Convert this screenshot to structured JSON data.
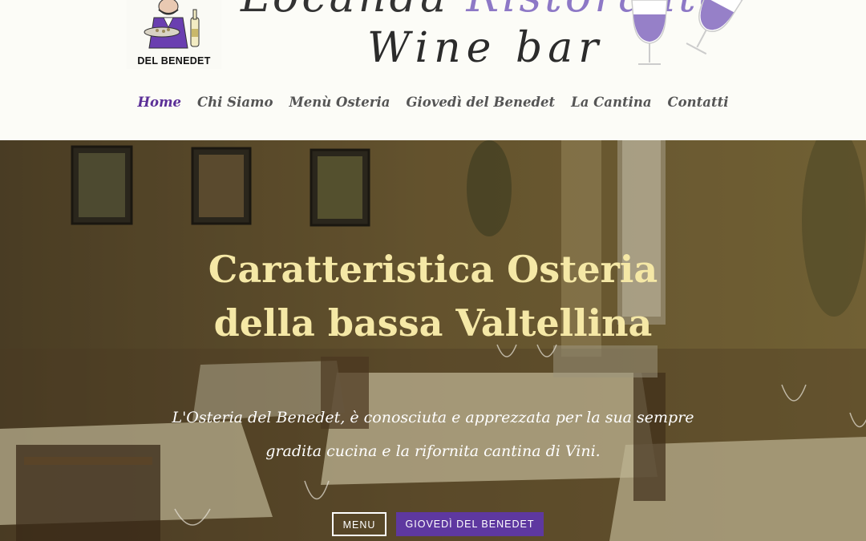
{
  "header": {
    "logo_caption": "DEL BENEDET",
    "script_top_left": "Locanda",
    "script_top_accent": "Ristorante",
    "wine_bar": "Wine bar"
  },
  "nav": {
    "items": [
      {
        "label": "Home",
        "active": true
      },
      {
        "label": "Chi Siamo",
        "active": false
      },
      {
        "label": "Menù Osteria",
        "active": false
      },
      {
        "label": "Giovedì del Benedet",
        "active": false
      },
      {
        "label": "La Cantina",
        "active": false
      },
      {
        "label": "Contatti",
        "active": false
      }
    ]
  },
  "hero": {
    "title_line1": "Caratteristica Osteria",
    "title_line2": "della bassa Valtellina",
    "subtitle_line1": "L'Osteria del Benedet, è conosciuta e apprezzata per la sua sempre",
    "subtitle_line2": "gradita cucina e la rifornita cantina di Vini.",
    "buttons": {
      "menu": "MENU",
      "giovedi": "GIOVEDÌ DEL BENEDET"
    }
  },
  "colors": {
    "accent_purple": "#5e38a0",
    "nav_active": "#5b2f97",
    "title_gold": "#f5e8a6",
    "header_bg": "#fcfcf7"
  }
}
